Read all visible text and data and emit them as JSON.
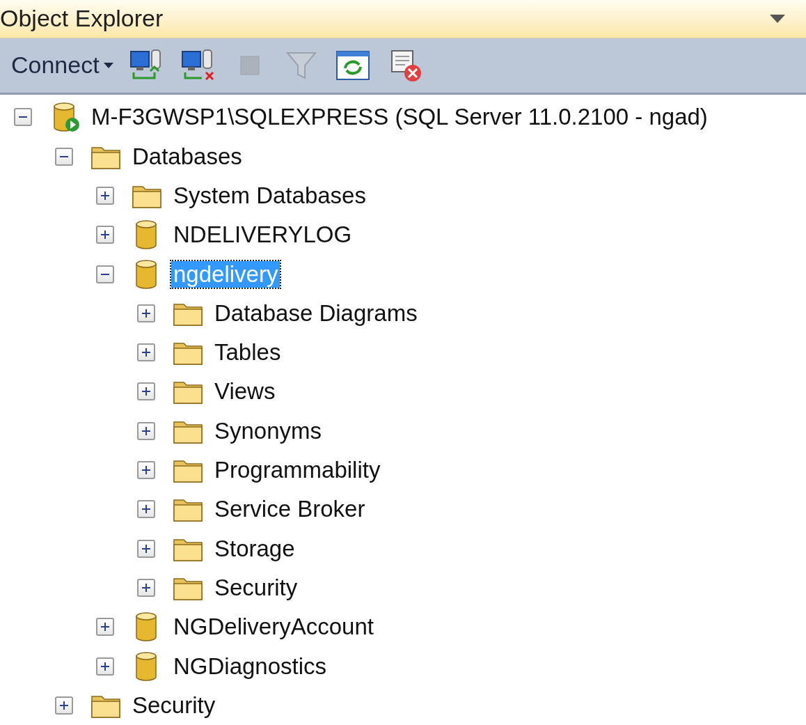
{
  "panel": {
    "title": "Object Explorer"
  },
  "toolbar": [
    {
      "kind": "connect-menu",
      "label": "Connect",
      "disabled": false
    },
    {
      "kind": "connect",
      "disabled": false
    },
    {
      "kind": "disconnect",
      "disabled": false
    },
    {
      "kind": "stop",
      "disabled": true
    },
    {
      "kind": "filter",
      "disabled": true
    },
    {
      "kind": "refresh",
      "disabled": false
    },
    {
      "kind": "script-cancel",
      "disabled": false
    }
  ],
  "tree": [
    {
      "kind": "server",
      "label": "M-F3GWSP1\\SQLEXPRESS (SQL Server 11.0.2100 - ngad)",
      "expanded": true,
      "selected": false,
      "children": [
        {
          "kind": "folder",
          "label": "Databases",
          "expanded": true,
          "selected": false,
          "children": [
            {
              "kind": "folder",
              "label": "System Databases",
              "expanded": false,
              "selected": false
            },
            {
              "kind": "database",
              "label": "NDELIVERYLOG",
              "expanded": false,
              "selected": false
            },
            {
              "kind": "database",
              "label": "ngdelivery",
              "expanded": true,
              "selected": true,
              "children": [
                {
                  "kind": "folder",
                  "label": "Database Diagrams",
                  "expanded": false,
                  "selected": false
                },
                {
                  "kind": "folder",
                  "label": "Tables",
                  "expanded": false,
                  "selected": false
                },
                {
                  "kind": "folder",
                  "label": "Views",
                  "expanded": false,
                  "selected": false
                },
                {
                  "kind": "folder",
                  "label": "Synonyms",
                  "expanded": false,
                  "selected": false
                },
                {
                  "kind": "folder",
                  "label": "Programmability",
                  "expanded": false,
                  "selected": false
                },
                {
                  "kind": "folder",
                  "label": "Service Broker",
                  "expanded": false,
                  "selected": false
                },
                {
                  "kind": "folder",
                  "label": "Storage",
                  "expanded": false,
                  "selected": false
                },
                {
                  "kind": "folder",
                  "label": "Security",
                  "expanded": false,
                  "selected": false
                }
              ]
            },
            {
              "kind": "database",
              "label": "NGDeliveryAccount",
              "expanded": false,
              "selected": false
            },
            {
              "kind": "database",
              "label": "NGDiagnostics",
              "expanded": false,
              "selected": false
            }
          ]
        },
        {
          "kind": "folder",
          "label": "Security",
          "expanded": false,
          "selected": false
        }
      ]
    }
  ]
}
